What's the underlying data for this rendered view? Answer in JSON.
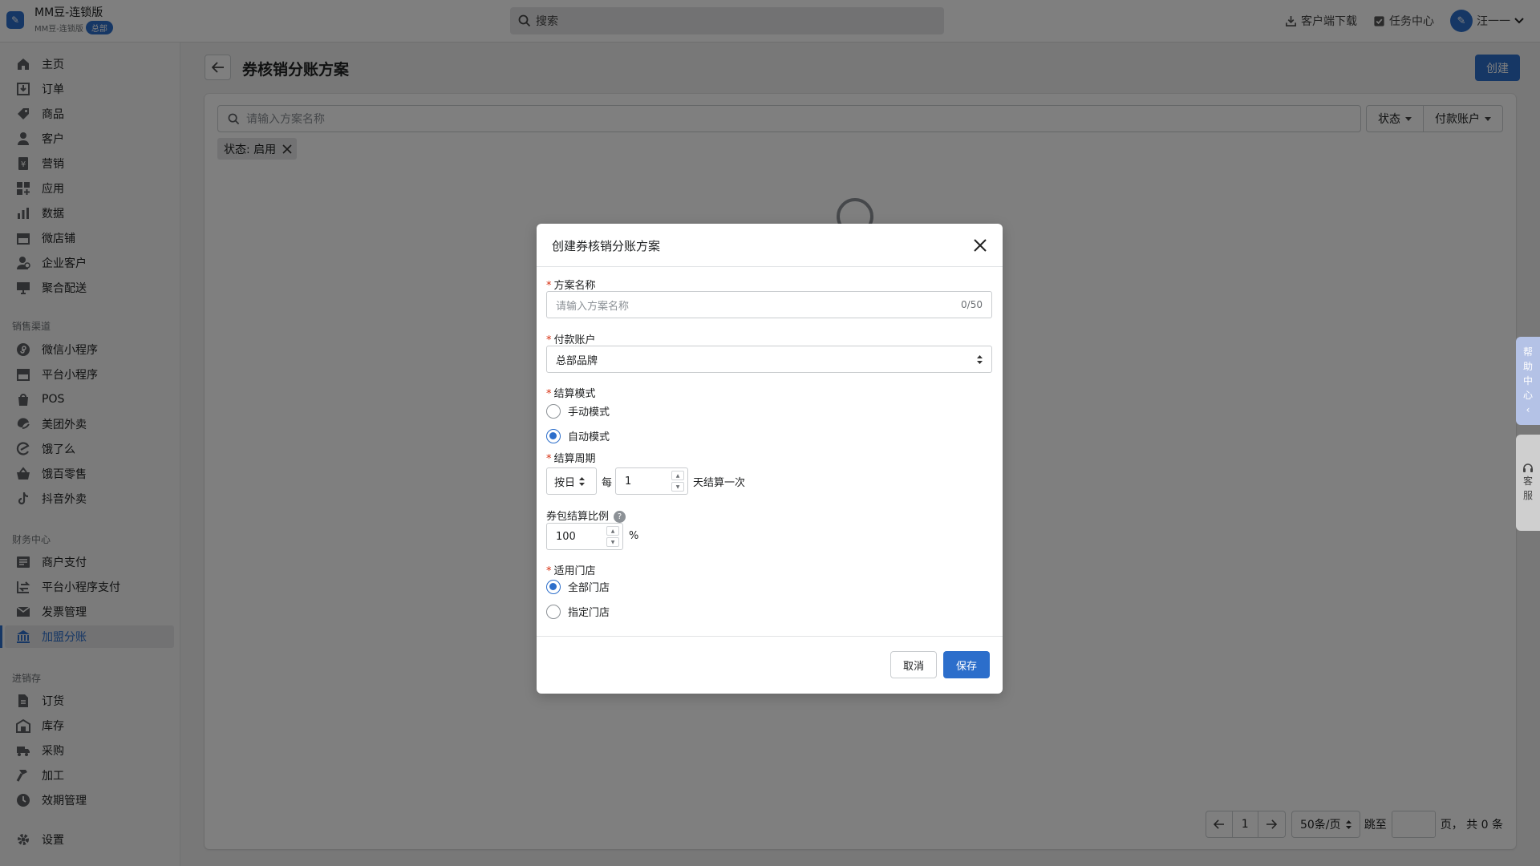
{
  "colors": {
    "accent": "#2c6ecb",
    "required": "#d72c0d"
  },
  "brand": {
    "name": "MM豆-连锁版",
    "sub": "MM豆-连锁版",
    "badge": "总部"
  },
  "search": {
    "placeholder": "搜索"
  },
  "topbar": {
    "download": "客户端下载",
    "tasks": "任务中心",
    "user": "汪一一"
  },
  "sidebar": {
    "items": [
      "主页",
      "订单",
      "商品",
      "客户",
      "营销",
      "应用",
      "数据",
      "微店铺",
      "企业客户",
      "聚合配送"
    ],
    "sales_title": "销售渠道",
    "sales": [
      "微信小程序",
      "平台小程序",
      "POS",
      "美团外卖",
      "饿了么",
      "饿百零售",
      "抖音外卖"
    ],
    "finance_title": "财务中心",
    "finance": [
      "商户支付",
      "平台小程序支付",
      "发票管理",
      "加盟分账"
    ],
    "inventory_title": "进销存",
    "inventory": [
      "订货",
      "库存",
      "采购",
      "加工",
      "效期管理"
    ],
    "settings": "设置"
  },
  "page": {
    "title": "券核销分账方案",
    "create": "创建"
  },
  "filters": {
    "placeholder": "请输入方案名称",
    "status": "状态",
    "account": "付款账户",
    "chip": "状态: 启用"
  },
  "pagination": {
    "page": "1",
    "per_page": "50条/页",
    "jump_label": "跳至",
    "suffix": "页，  共 0 条"
  },
  "side_tabs": {
    "help": [
      "帮",
      "助",
      "中",
      "心"
    ],
    "support": [
      "客",
      "服"
    ]
  },
  "modal": {
    "title": "创建券核销分账方案",
    "name_label": "方案名称",
    "name_placeholder": "请输入方案名称",
    "name_count": "0/50",
    "account_label": "付款账户",
    "account_value": "总部品牌",
    "mode_label": "结算模式",
    "mode_manual": "手动模式",
    "mode_auto": "自动模式",
    "mode_selected": "自动模式",
    "cycle_label": "结算周期",
    "cycle_unit": "按日",
    "cycle_every": "每",
    "cycle_value": "1",
    "cycle_suffix": "天结算一次",
    "ratio_label": "券包结算比例",
    "ratio_value": "100",
    "ratio_unit": "%",
    "store_label": "适用门店",
    "store_all": "全部门店",
    "store_specific": "指定门店",
    "store_selected": "全部门店",
    "cancel": "取消",
    "save": "保存"
  }
}
